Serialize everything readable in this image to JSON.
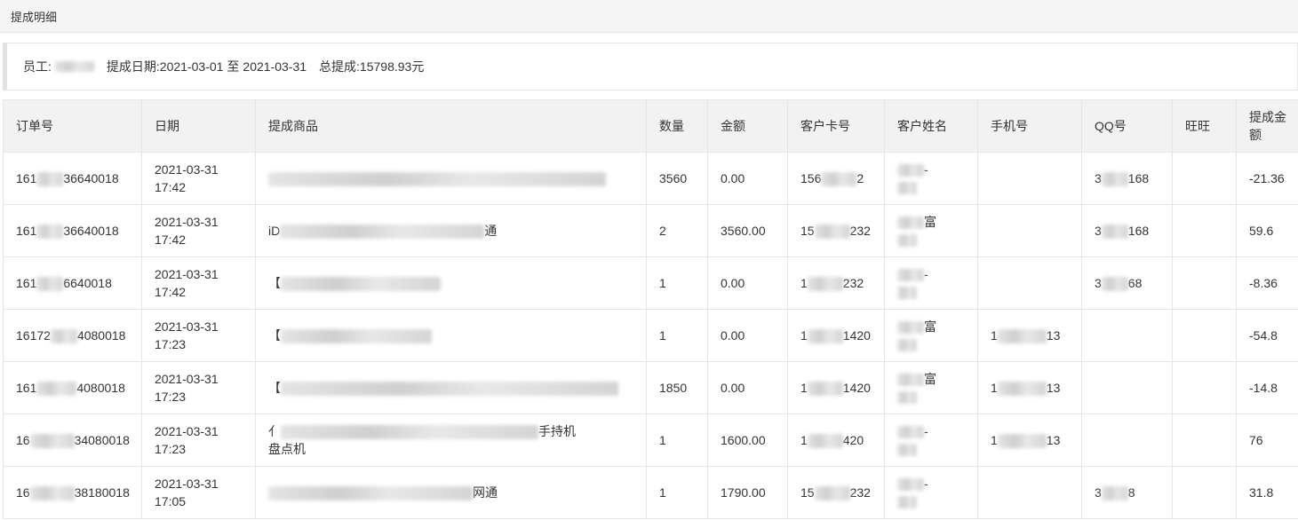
{
  "page_title": "提成明细",
  "summary": {
    "employee_label": "员工:",
    "employee_visible": "",
    "date_label": "提成日期:",
    "date_from": "2021-03-01",
    "date_sep": "至",
    "date_to": "2021-03-31",
    "total_label": "总提成:",
    "total_value": "15798.93元"
  },
  "columns": [
    "订单号",
    "日期",
    "提成商品",
    "数量",
    "金额",
    "客户卡号",
    "客户姓名",
    "手机号",
    "QQ号",
    "旺旺",
    "提成金额"
  ],
  "rows": [
    {
      "order_prefix": "161",
      "order_suffix": "36640018",
      "date": "2021-03-31",
      "time": "17:42",
      "product_pre": "",
      "product_post": "",
      "qty": "3560",
      "amount": "0.00",
      "card_pre": "156",
      "card_post": "2",
      "phone_pre": "",
      "phone_post": "",
      "qq_pre": "3",
      "qq_post": "168",
      "commission": "-21.36"
    },
    {
      "order_prefix": "161",
      "order_suffix": "36640018",
      "date": "2021-03-31",
      "time": "17:42",
      "product_pre": "iD",
      "product_post": "通",
      "qty": "2",
      "amount": "3560.00",
      "card_pre": "15",
      "card_post": "232",
      "phone_pre": "",
      "phone_post": "",
      "qq_pre": "3",
      "qq_post": "168",
      "commission": "59.6"
    },
    {
      "order_prefix": "161",
      "order_suffix": "6640018",
      "date": "2021-03-31",
      "time": "17:42",
      "product_pre": "【",
      "product_post": "",
      "qty": "1",
      "amount": "0.00",
      "card_pre": "1",
      "card_post": "232",
      "phone_pre": "",
      "phone_post": "",
      "qq_pre": "3",
      "qq_post": "68",
      "commission": "-8.36"
    },
    {
      "order_prefix": "16172",
      "order_suffix": "4080018",
      "date": "2021-03-31",
      "time": "17:23",
      "product_pre": "【",
      "product_post": "",
      "qty": "1",
      "amount": "0.00",
      "card_pre": "1",
      "card_post": "1420",
      "phone_pre": "1",
      "phone_post": "13",
      "qq_pre": "",
      "qq_post": "",
      "commission": "-54.8"
    },
    {
      "order_prefix": "161",
      "order_suffix": "4080018",
      "date": "2021-03-31",
      "time": "17:23",
      "product_pre": "【",
      "product_post": "",
      "qty": "1850",
      "amount": "0.00",
      "card_pre": "1",
      "card_post": "1420",
      "phone_pre": "1",
      "phone_post": "13",
      "qq_pre": "",
      "qq_post": "",
      "commission": "-14.8"
    },
    {
      "order_prefix": "16",
      "order_suffix": "34080018",
      "date": "2021-03-31",
      "time": "17:23",
      "product_pre": "亻",
      "product_post": "手持机",
      "product_line2": "盘点机",
      "qty": "1",
      "amount": "1600.00",
      "card_pre": "1",
      "card_post": "420",
      "phone_pre": "1",
      "phone_post": "13",
      "qq_pre": "",
      "qq_post": "",
      "commission": "76"
    },
    {
      "order_prefix": "16",
      "order_suffix": "38180018",
      "date": "2021-03-31",
      "time": "17:05",
      "product_pre": "",
      "product_post": "网通",
      "qty": "1",
      "amount": "1790.00",
      "card_pre": "15",
      "card_post": "232",
      "phone_pre": "",
      "phone_post": "",
      "qq_pre": "3",
      "qq_post": "8",
      "commission": "31.8"
    }
  ],
  "name_fragments": [
    "-",
    "富",
    "-",
    "富",
    "富",
    "-",
    "-"
  ]
}
